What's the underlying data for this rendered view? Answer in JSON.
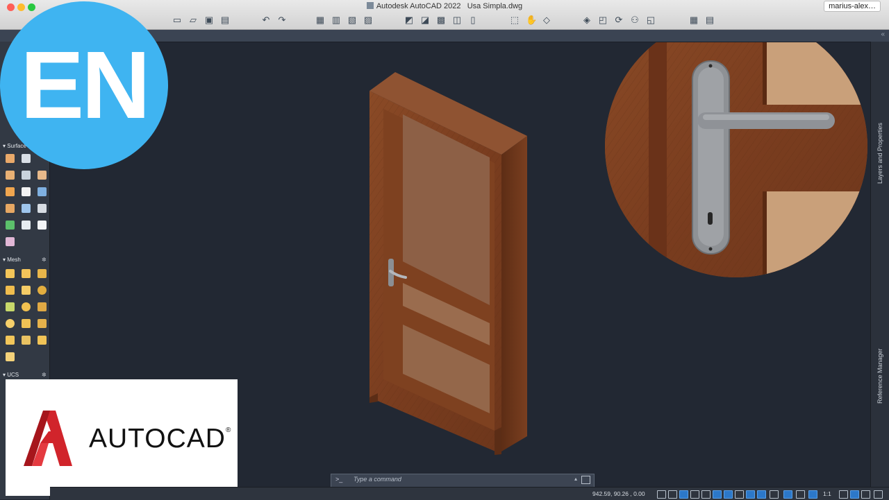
{
  "window": {
    "title": "Autodesk AutoCAD 2022",
    "document": "Usa Simpla.dwg",
    "user": "marius-alex…"
  },
  "toolbar": {
    "file_icons": [
      "new-file-icon",
      "open-file-icon",
      "save-icon",
      "save-as-icon"
    ],
    "edit_icons": [
      "undo-icon",
      "redo-icon"
    ],
    "print_icons": [
      "plot-icon",
      "batch-plot-icon",
      "publish-icon",
      "sheet-set-icon"
    ],
    "view_icons": [
      "zoom-window-icon",
      "pan-icon",
      "orbit-icon"
    ]
  },
  "palette": {
    "sections": [
      {
        "label": "Surface"
      },
      {
        "label": "Mesh"
      },
      {
        "label": "UCS"
      }
    ]
  },
  "side_panels": {
    "layers": "Layers and Properties",
    "reference": "Reference Manager"
  },
  "command_line": {
    "prompt": ">_",
    "placeholder": "Type a command"
  },
  "status_bar": {
    "coordinates": "942.59,  90.26  , 0.00",
    "scale": "1:1"
  },
  "overlays": {
    "language_badge": "EN",
    "logo_text": "AUTOCAD",
    "logo_mark": "®"
  }
}
